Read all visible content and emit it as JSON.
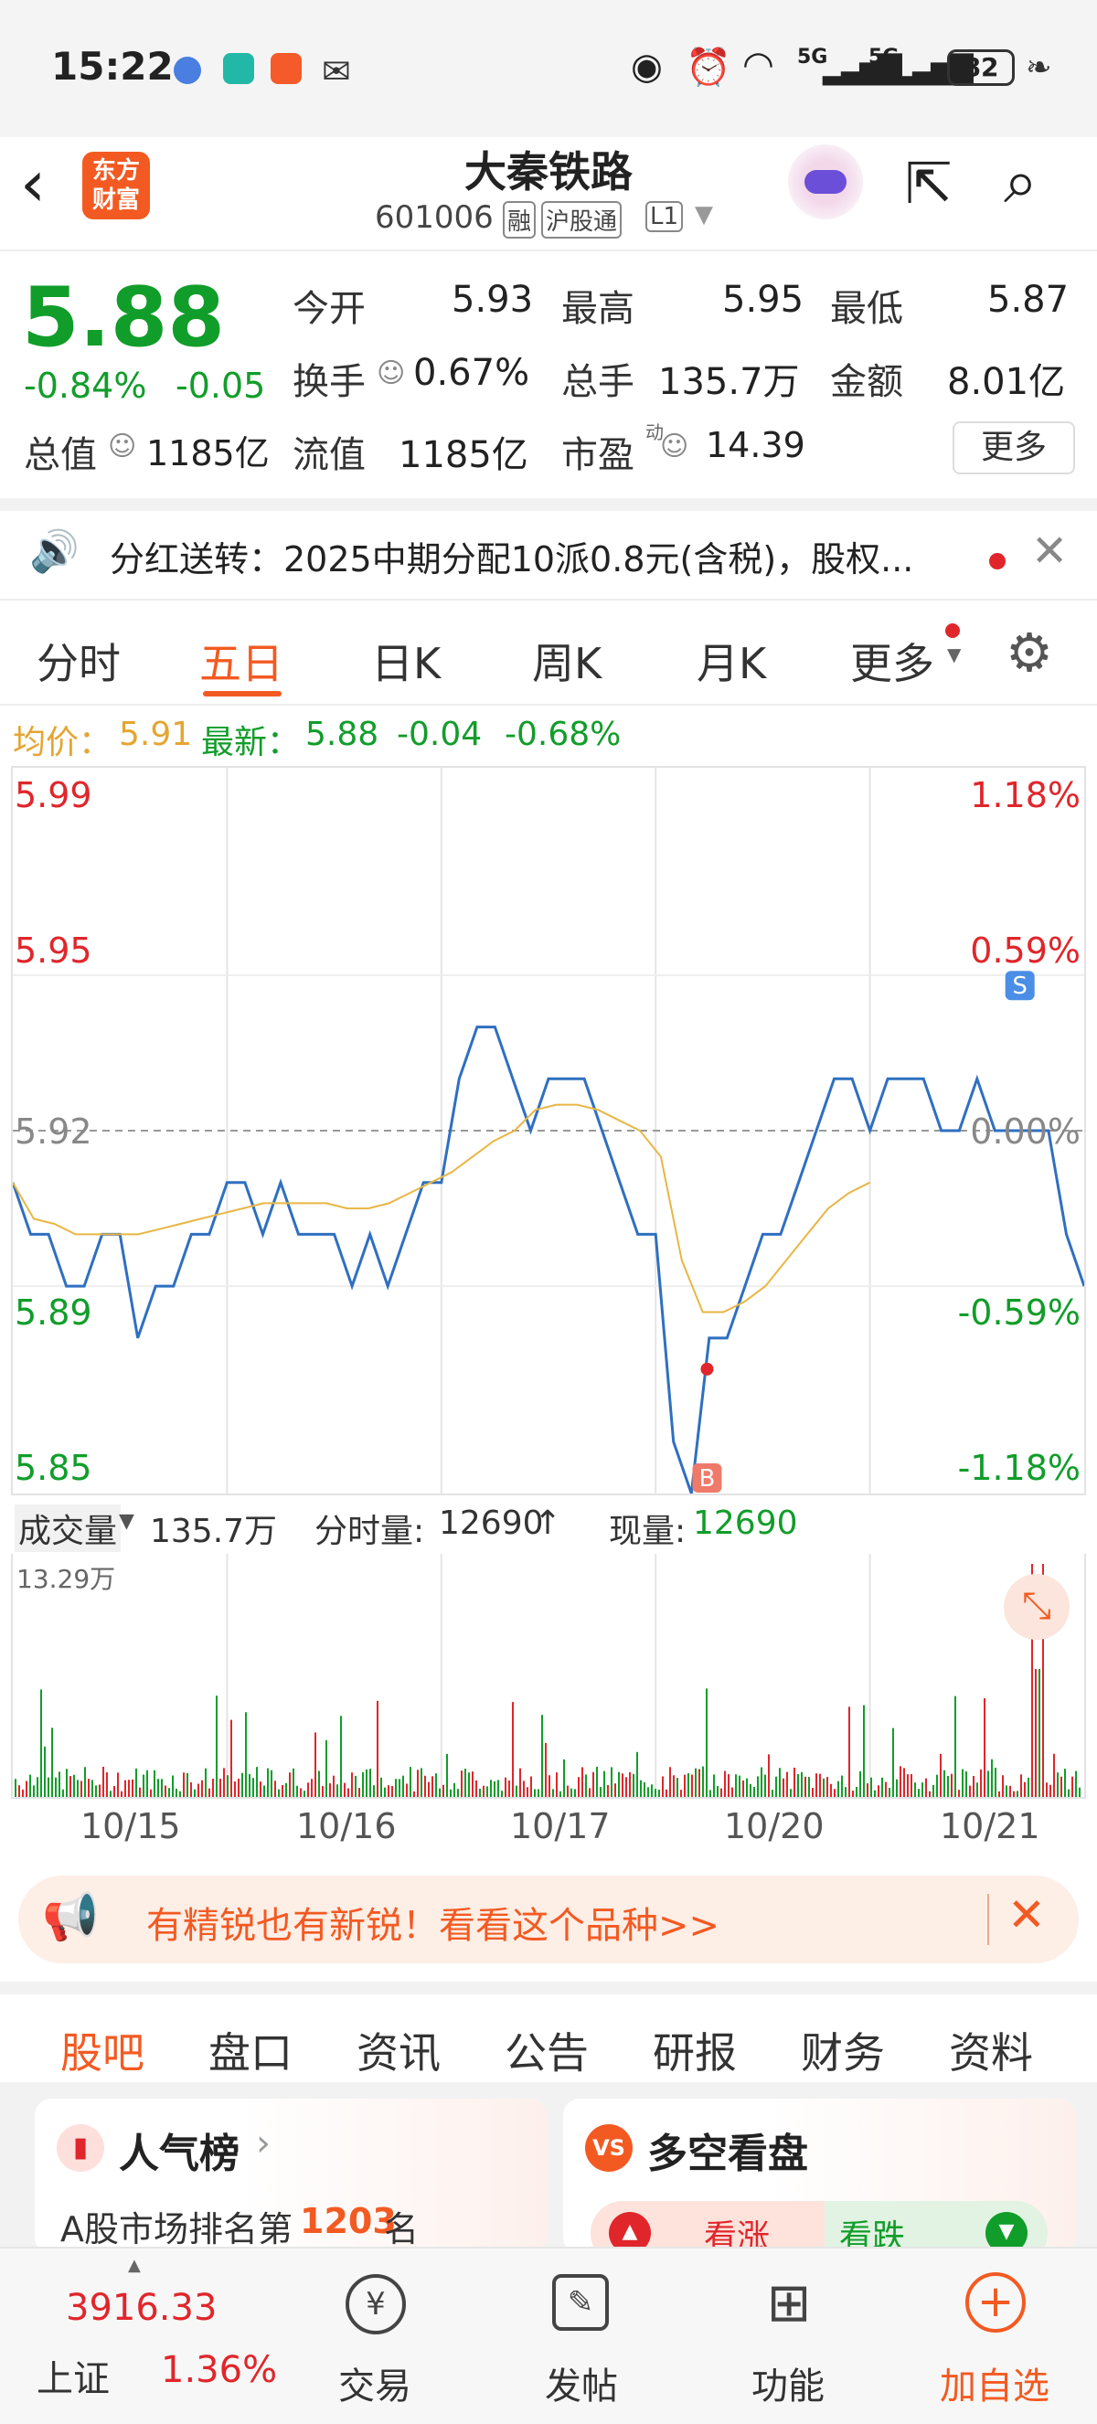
{
  "status": {
    "time": "15:22",
    "battery": "82",
    "icons": [
      "bluetooth-like-icon",
      "boss-app-icon",
      "shop-app-icon",
      "wechat-icon",
      "eye-icon",
      "alarm-icon",
      "wifi-icon",
      "signal-5g-icon",
      "signal-5g-icon",
      "leaf-icon"
    ],
    "net1": "5G",
    "net2": "5G"
  },
  "header": {
    "title": "大秦铁路",
    "code": "601006",
    "tags": [
      "融",
      "沪股通",
      "L1"
    ],
    "logo_line1": "东方",
    "logo_line2": "财富"
  },
  "quote": {
    "price": "5.88",
    "pct": "-0.84%",
    "chg": "-0.05",
    "rows": [
      [
        {
          "l": "今开",
          "v": "5.93",
          "c": "dark"
        },
        {
          "l": "最高",
          "v": "5.95",
          "c": "red"
        },
        {
          "l": "最低",
          "v": "5.87",
          "c": "green"
        }
      ],
      [
        {
          "l": "换手",
          "v": "0.67%",
          "c": "dark"
        },
        {
          "l": "总手",
          "v": "135.7万",
          "c": "dark"
        },
        {
          "l": "金额",
          "v": "8.01亿",
          "c": "dark"
        }
      ]
    ],
    "total_mv_label": "总值",
    "total_mv": "1185亿",
    "float_label": "流值",
    "float_mv": "1185亿",
    "pe_label": "市盈",
    "pe_sup": "动",
    "pe": "14.39",
    "more": "更多"
  },
  "announcement": {
    "text": "分红送转：2025中期分配10派0.8元(含税)，股权..."
  },
  "tabs": [
    "分时",
    "五日",
    "日K",
    "周K",
    "月K",
    "更多"
  ],
  "active_tab": 1,
  "info": {
    "avg_label": "均价：",
    "avg": "5.91",
    "new_label": "最新：",
    "new": "5.88",
    "chg": "-0.04",
    "pct": "-0.68%"
  },
  "chart_data": {
    "type": "line",
    "title": "",
    "y_labels_left": [
      "5.99",
      "5.95",
      "5.92",
      "5.89",
      "5.85"
    ],
    "y_labels_right": [
      "1.18%",
      "0.59%",
      "0.00%",
      "-0.59%",
      "-1.18%"
    ],
    "ylim": [
      5.85,
      5.99
    ],
    "baseline": 5.92,
    "x": [
      "10/15",
      "10/16",
      "10/17",
      "10/20",
      "10/21"
    ],
    "markers": [
      {
        "label": "S",
        "day": "10/21"
      },
      {
        "label": "B",
        "day": "10/20"
      }
    ],
    "series": [
      {
        "values": [
          5.91,
          5.9,
          5.9,
          5.89,
          5.89,
          5.9,
          5.9,
          5.88,
          5.89,
          5.89,
          5.9,
          5.9,
          5.91,
          5.91,
          5.9,
          5.91,
          5.9,
          5.9,
          5.9,
          5.89,
          5.9,
          5.89,
          5.9,
          5.91,
          5.91,
          5.93,
          5.94,
          5.94,
          5.93,
          5.92,
          5.93,
          5.93,
          5.93,
          5.92,
          5.91,
          5.9,
          5.9,
          5.86,
          5.85,
          5.88,
          5.88,
          5.89,
          5.9,
          5.9,
          5.91,
          5.92,
          5.93,
          5.93,
          5.92,
          5.93,
          5.93,
          5.93,
          5.92,
          5.92,
          5.93,
          5.92,
          5.92,
          5.92,
          5.92,
          5.9,
          5.89
        ]
      },
      {
        "values": [
          5.91,
          5.903,
          5.902,
          5.9,
          5.9,
          5.9,
          5.9,
          5.901,
          5.902,
          5.903,
          5.904,
          5.905,
          5.906,
          5.906,
          5.906,
          5.906,
          5.905,
          5.905,
          5.906,
          5.908,
          5.91,
          5.912,
          5.915,
          5.918,
          5.92,
          5.924,
          5.925,
          5.925,
          5.924,
          5.922,
          5.92,
          5.915,
          5.895,
          5.885,
          5.885,
          5.887,
          5.89,
          5.895,
          5.9,
          5.905,
          5.908,
          5.91
        ]
      }
    ]
  },
  "volume": {
    "label": "成交量",
    "total": "135.7万",
    "minute_label": "分时量:",
    "minute": "12690",
    "arrow": "↑",
    "now_label": "现量:",
    "now": "12690",
    "max": "13.29万"
  },
  "ad": {
    "text": "有精锐也有新锐！看看这个品种>>"
  },
  "bottom_tabs": [
    "股吧",
    "盘口",
    "资讯",
    "公告",
    "研报",
    "财务",
    "资料"
  ],
  "cards": {
    "left_title": "人气榜",
    "left_sub_pre": "A股市场排名第",
    "left_rank": "1203",
    "left_sub_post": "名",
    "right_title": "多空看盘",
    "bull": "看涨",
    "bear": "看跌"
  },
  "nav": {
    "index_value": "3916.33",
    "index_name": "上证",
    "index_pct": "1.36%",
    "items": [
      "交易",
      "发帖",
      "功能",
      "加自选"
    ]
  }
}
